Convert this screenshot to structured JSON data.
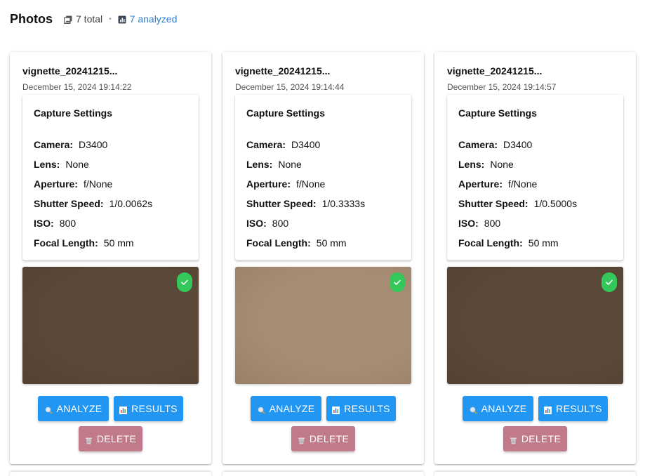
{
  "header": {
    "title": "Photos",
    "total_label": "7 total",
    "analyzed_label": "7 analyzed",
    "separator": "•"
  },
  "colors": {
    "accent": "#2196f3",
    "delete": "#c07a89",
    "success": "#34c759",
    "link": "#2f7fd0"
  },
  "photos": [
    {
      "filename": "vignette_20241215...",
      "timestamp": "December 15, 2024 19:14:22",
      "settings_title": "Capture Settings",
      "camera_label": "Camera:",
      "camera": "D3400",
      "lens_label": "Lens:",
      "lens": "None",
      "aperture_label": "Aperture:",
      "aperture": "f/None",
      "shutter_label": "Shutter Speed:",
      "shutter": "1/0.0062s",
      "iso_label": "ISO:",
      "iso": "800",
      "focal_label": "Focal Length:",
      "focal": "50 mm",
      "preview_color": "#5a4838",
      "analyzed": true,
      "analyze_label": "ANALYZE",
      "results_label": "RESULTS",
      "delete_label": "DELETE"
    },
    {
      "filename": "vignette_20241215...",
      "timestamp": "December 15, 2024 19:14:44",
      "settings_title": "Capture Settings",
      "camera_label": "Camera:",
      "camera": "D3400",
      "lens_label": "Lens:",
      "lens": "None",
      "aperture_label": "Aperture:",
      "aperture": "f/None",
      "shutter_label": "Shutter Speed:",
      "shutter": "1/0.3333s",
      "iso_label": "ISO:",
      "iso": "800",
      "focal_label": "Focal Length:",
      "focal": "50 mm",
      "preview_color": "#a68c72",
      "analyzed": true,
      "analyze_label": "ANALYZE",
      "results_label": "RESULTS",
      "delete_label": "DELETE"
    },
    {
      "filename": "vignette_20241215...",
      "timestamp": "December 15, 2024 19:14:57",
      "settings_title": "Capture Settings",
      "camera_label": "Camera:",
      "camera": "D3400",
      "lens_label": "Lens:",
      "lens": "None",
      "aperture_label": "Aperture:",
      "aperture": "f/None",
      "shutter_label": "Shutter Speed:",
      "shutter": "1/0.5000s",
      "iso_label": "ISO:",
      "iso": "800",
      "focal_label": "Focal Length:",
      "focal": "50 mm",
      "preview_color": "#5a4838",
      "analyzed": true,
      "analyze_label": "ANALYZE",
      "results_label": "RESULTS",
      "delete_label": "DELETE"
    }
  ]
}
